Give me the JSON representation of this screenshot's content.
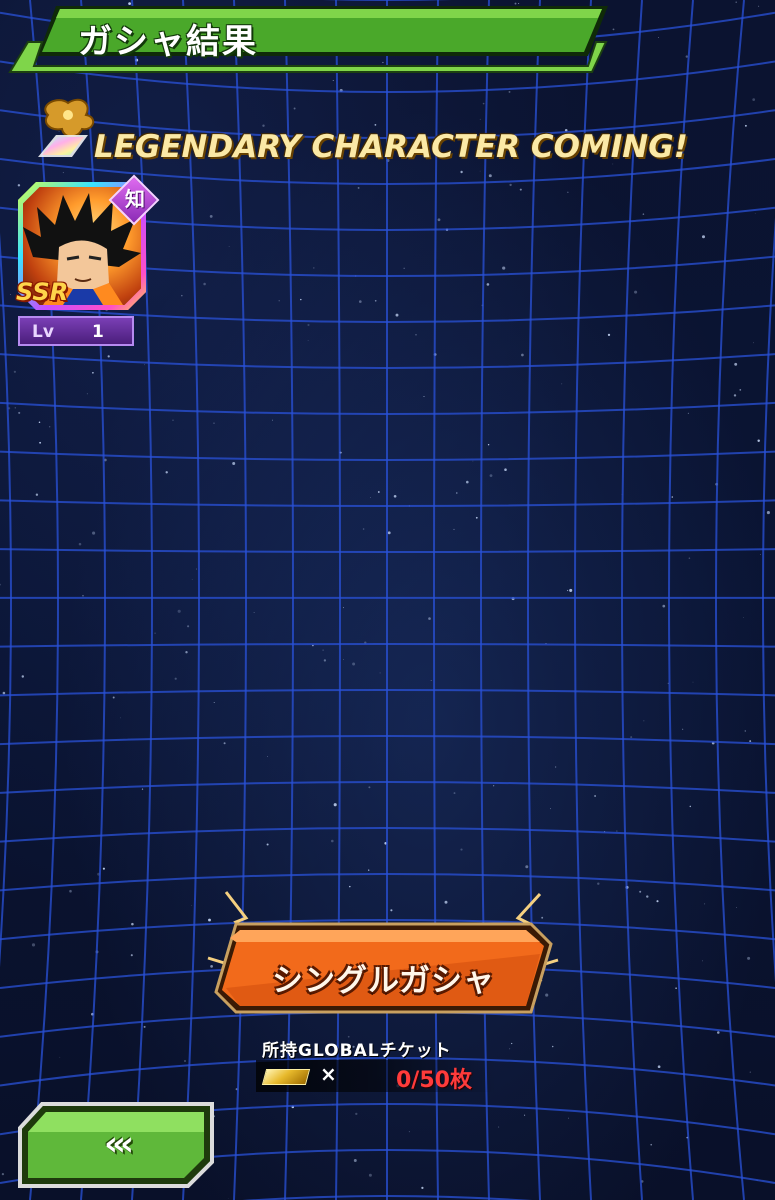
{
  "header": {
    "title": "ガシャ結果"
  },
  "banner": {
    "text": "LEGENDARY CHARACTER COMING!"
  },
  "character": {
    "type_badge": "知",
    "rarity": "SSR",
    "level_label": "Lv",
    "level_value": "1"
  },
  "gacha_button": {
    "label": "シングルガシャ"
  },
  "ticket": {
    "title": "所持GLOBALチケット",
    "times": "×",
    "count": "0/50枚"
  },
  "back_button": {
    "label": "‹‹‹"
  },
  "colors": {
    "header_green": "#4aa82a",
    "button_orange": "#f26a1b",
    "back_green": "#5fb83a",
    "grid_line": "#2a52d8",
    "ticket_count_red": "#ff3b3b"
  }
}
